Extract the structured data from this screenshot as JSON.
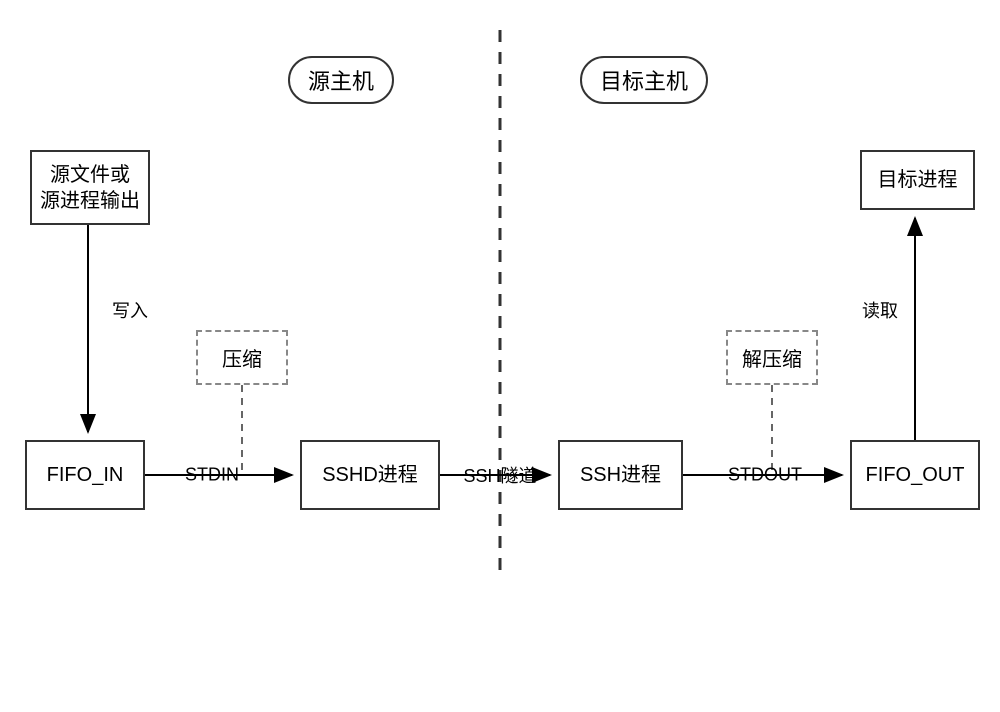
{
  "chart_data": {
    "type": "diagram",
    "title": "",
    "hosts": [
      {
        "id": "source_host",
        "label": "源主机",
        "side": "left"
      },
      {
        "id": "target_host",
        "label": "目标主机",
        "side": "right"
      }
    ],
    "nodes": [
      {
        "id": "source_input",
        "label": "源文件或\n源进程输出",
        "host": "source_host",
        "type": "solid"
      },
      {
        "id": "fifo_in",
        "label": "FIFO_IN",
        "host": "source_host",
        "type": "solid"
      },
      {
        "id": "compress",
        "label": "压缩",
        "host": "source_host",
        "type": "dashed"
      },
      {
        "id": "sshd",
        "label": "SSHD进程",
        "host": "source_host",
        "type": "solid"
      },
      {
        "id": "ssh",
        "label": "SSH进程",
        "host": "target_host",
        "type": "solid"
      },
      {
        "id": "decompress",
        "label": "解压缩",
        "host": "target_host",
        "type": "dashed"
      },
      {
        "id": "fifo_out",
        "label": "FIFO_OUT",
        "host": "target_host",
        "type": "solid"
      },
      {
        "id": "target_proc",
        "label": "目标进程",
        "host": "target_host",
        "type": "solid"
      }
    ],
    "edges": [
      {
        "from": "source_input",
        "to": "fifo_in",
        "label": "写入",
        "style": "solid",
        "arrow": true
      },
      {
        "from": "fifo_in",
        "to": "sshd",
        "label": "STDIN",
        "style": "solid",
        "arrow": true
      },
      {
        "from": "compress",
        "to": "stdin_edge",
        "label": "",
        "style": "dashed",
        "arrow": false
      },
      {
        "from": "sshd",
        "to": "ssh",
        "label": "SSH隧道",
        "style": "solid",
        "arrow": true
      },
      {
        "from": "ssh",
        "to": "fifo_out",
        "label": "STDOUT",
        "style": "solid",
        "arrow": true
      },
      {
        "from": "decompress",
        "to": "stdout_edge",
        "label": "",
        "style": "dashed",
        "arrow": false
      },
      {
        "from": "fifo_out",
        "to": "target_proc",
        "label": "读取",
        "style": "solid",
        "arrow": true
      }
    ]
  },
  "labels": {
    "source_host": "源主机",
    "target_host": "目标主机",
    "source_input": "源文件或\n源进程输出",
    "fifo_in": "FIFO_IN",
    "compress": "压缩",
    "sshd": "SSHD进程",
    "ssh": "SSH进程",
    "decompress": "解压缩",
    "fifo_out": "FIFO_OUT",
    "target_proc": "目标进程",
    "edge_write": "写入",
    "edge_stdin": "STDIN",
    "edge_tunnel": "SSH隧道",
    "edge_stdout": "STDOUT",
    "edge_read": "读取"
  }
}
